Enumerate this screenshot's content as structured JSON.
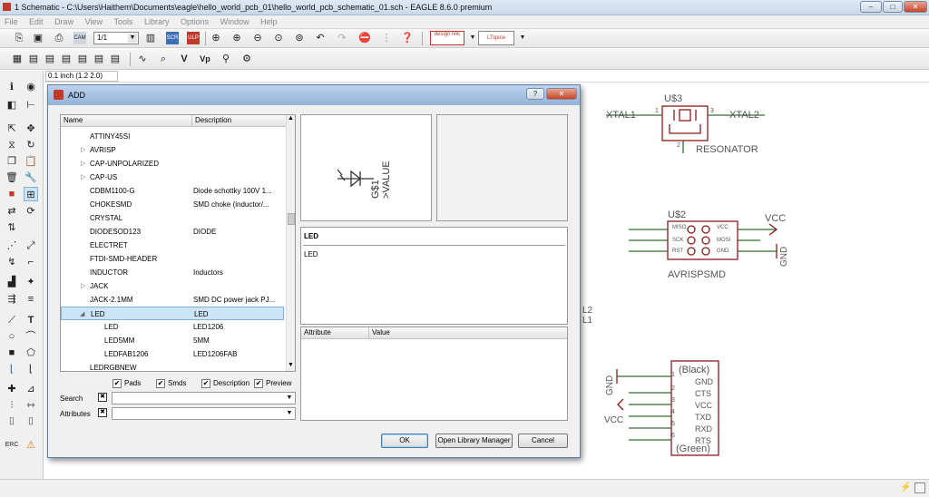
{
  "window": {
    "title": "1 Schematic - C:\\Users\\Haithem\\Documents\\eagle\\hello_world_pcb_01\\hello_world_pcb_schematic_01.sch - EAGLE 8.6.0 premium",
    "minimize": "–",
    "maximize": "□",
    "close": "✕"
  },
  "menu": [
    "File",
    "Edit",
    "Draw",
    "View",
    "Tools",
    "Library",
    "Options",
    "Window",
    "Help"
  ],
  "toolbar": {
    "sheet_combo": "1/1",
    "design_link": "design link",
    "ltspice": "LTspice"
  },
  "toolbar2": [
    "∿",
    "⌕",
    "V",
    "Vp",
    "⚲",
    "⚙"
  ],
  "coord": "0.1 inch (1.2 2.0)",
  "dialog": {
    "title": "ADD",
    "help": "?",
    "close": "✕",
    "col_name": "Name",
    "col_description": "Description",
    "items": [
      {
        "name": "ATTINY45SI",
        "desc": "",
        "indent": 1,
        "expander": ""
      },
      {
        "name": "AVRISP",
        "desc": "",
        "indent": 1,
        "expander": "▷"
      },
      {
        "name": "CAP-UNPOLARIZED",
        "desc": "",
        "indent": 1,
        "expander": "▷"
      },
      {
        "name": "CAP-US",
        "desc": "",
        "indent": 1,
        "expander": "▷"
      },
      {
        "name": "CDBM1100-G",
        "desc": "Diode schottky 100V 1...",
        "indent": 1,
        "expander": ""
      },
      {
        "name": "CHOKESMD",
        "desc": "SMD choke (inductor/...",
        "indent": 1,
        "expander": ""
      },
      {
        "name": "CRYSTAL",
        "desc": "",
        "indent": 1,
        "expander": ""
      },
      {
        "name": "DIODESOD123",
        "desc": "DIODE",
        "indent": 1,
        "expander": ""
      },
      {
        "name": "ELECTRET",
        "desc": "",
        "indent": 1,
        "expander": ""
      },
      {
        "name": "FTDI-SMD-HEADER",
        "desc": "",
        "indent": 1,
        "expander": ""
      },
      {
        "name": "INDUCTOR",
        "desc": "Inductors",
        "indent": 1,
        "expander": ""
      },
      {
        "name": "JACK",
        "desc": "",
        "indent": 1,
        "expander": "▷"
      },
      {
        "name": "JACK-2.1MM",
        "desc": "SMD DC power jack PJ...",
        "indent": 1,
        "expander": ""
      },
      {
        "name": "LED",
        "desc": "LED",
        "indent": 0,
        "expander": "◢",
        "selected": true
      },
      {
        "name": "LED",
        "desc": "LED1206",
        "indent": 2,
        "expander": ""
      },
      {
        "name": "LED5MM",
        "desc": "5MM",
        "indent": 2,
        "expander": ""
      },
      {
        "name": "LEDFAB1206",
        "desc": "LED1206FAB",
        "indent": 2,
        "expander": ""
      },
      {
        "name": "LEDRGBNEW",
        "desc": "",
        "indent": 0,
        "expander": ""
      }
    ],
    "preview": {
      "part_name": "G$1",
      "part_value": ">VALUE"
    },
    "info_title": "LED",
    "info_text": "LED",
    "col_attribute": "Attribute",
    "col_value": "Value",
    "checks": [
      {
        "label": "Pads",
        "checked": true
      },
      {
        "label": "Smds",
        "checked": true
      },
      {
        "label": "Description",
        "checked": true
      },
      {
        "label": "Preview",
        "checked": true
      }
    ],
    "search_label": "Search",
    "search_value": "",
    "attributes_label": "Attributes",
    "attributes_value": "",
    "ok": "OK",
    "library_manager": "Open Library Manager",
    "cancel": "Cancel"
  },
  "schematic": {
    "u3": {
      "name": "U$3",
      "xtal1": "XTAL1",
      "xtal2": "XTAL2",
      "pin1": "1",
      "pin2": "2",
      "pin3": "3",
      "value": "RESONATOR"
    },
    "u2": {
      "name": "U$2",
      "vcc_label": "VCC",
      "gnd_label": "GND",
      "pins": [
        "MISO",
        "VCC",
        "SCK",
        "MOSI",
        "RST",
        "GND"
      ],
      "value": "AVRISPSMD"
    },
    "ftdi": {
      "top": "(Black)",
      "bottom": "(Green)",
      "gnd_label": "GND",
      "vcc_label": "VCC",
      "pins": [
        "GND",
        "CTS",
        "VCC",
        "TXD",
        "RXD",
        "RTS"
      ],
      "nums": [
        "1",
        "2",
        "3",
        "4",
        "5",
        "6"
      ]
    },
    "partial_labels": [
      "L2",
      "L1"
    ]
  },
  "colors": {
    "symbol": "#8b1a1a",
    "net": "#2f6f2f",
    "selection": "#cce4f7"
  }
}
